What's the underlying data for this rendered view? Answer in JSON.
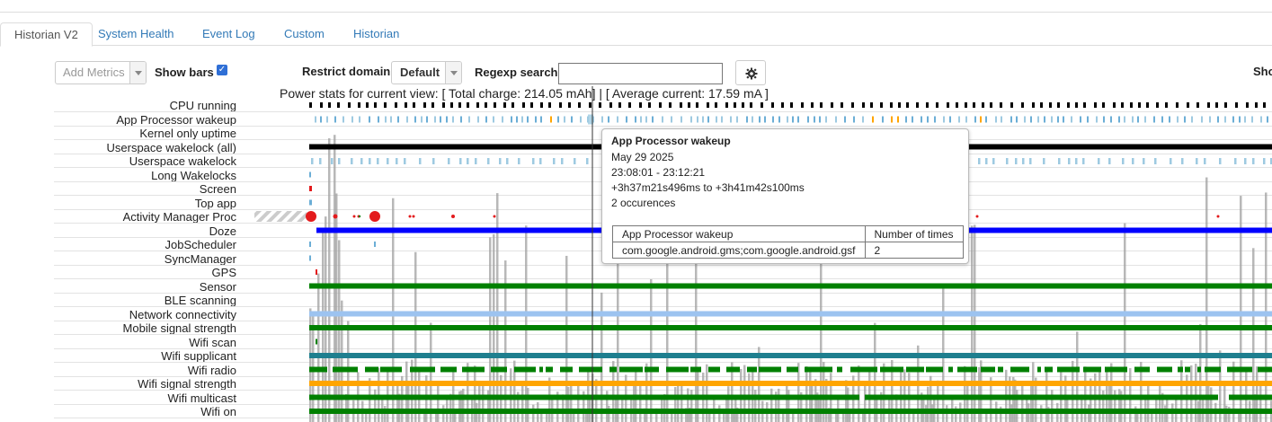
{
  "tabs": [
    {
      "label": "Historian V2",
      "active": true
    },
    {
      "label": "System Health"
    },
    {
      "label": "Event Log"
    },
    {
      "label": "Custom"
    },
    {
      "label": "Historian"
    }
  ],
  "toolbar": {
    "add_metrics_placeholder": "Add Metrics",
    "show_bars_label": "Show bars",
    "show_bars_checked": true,
    "restrict_domain_label": "Restrict domain",
    "restrict_domain_value": "Default",
    "regexp_search_label": "Regexp search",
    "regexp_search_value": "",
    "settings_icon": "gear-icon",
    "show_cut_label": "Sho"
  },
  "power_stats": "Power stats for current view: [ Total charge: 214.05 mAh] | [ Average current: 17.59 mA ]",
  "metrics": [
    "CPU running",
    "App Processor wakeup",
    "Kernel only uptime",
    "Userspace wakelock (all)",
    "Userspace wakelock",
    "Long Wakelocks",
    "Screen",
    "Top app",
    "Activity Manager Proc",
    "Doze",
    "JobScheduler",
    "SyncManager",
    "GPS",
    "Sensor",
    "BLE scanning",
    "Network connectivity",
    "Mobile signal strength",
    "Wifi scan",
    "Wifi supplicant",
    "Wifi radio",
    "Wifi signal strength",
    "Wifi multicast",
    "Wifi on"
  ],
  "colors": {
    "black": "#000000",
    "light_blue": "#6baed6",
    "pale_blue": "#9ecae1",
    "blue": "#0000ff",
    "green": "#008000",
    "teal": "#1f7f8f",
    "orange": "#ffa500",
    "red": "#e31a1c",
    "gray_bar": "#a0a0a0",
    "network_blue": "#9cc3f0"
  },
  "tooltip": {
    "title": "App Processor wakeup",
    "date": "May 29 2025",
    "time_range": "23:08:01 - 23:12:21",
    "offset_range": "+3h37m21s496ms to +3h41m42s100ms",
    "occurrences": "2 occurences",
    "table_header": [
      "App Processor wakeup",
      "Number of times"
    ],
    "table_rows": [
      [
        "com.google.android.gms;com.google.android.gsf",
        "2"
      ]
    ]
  }
}
